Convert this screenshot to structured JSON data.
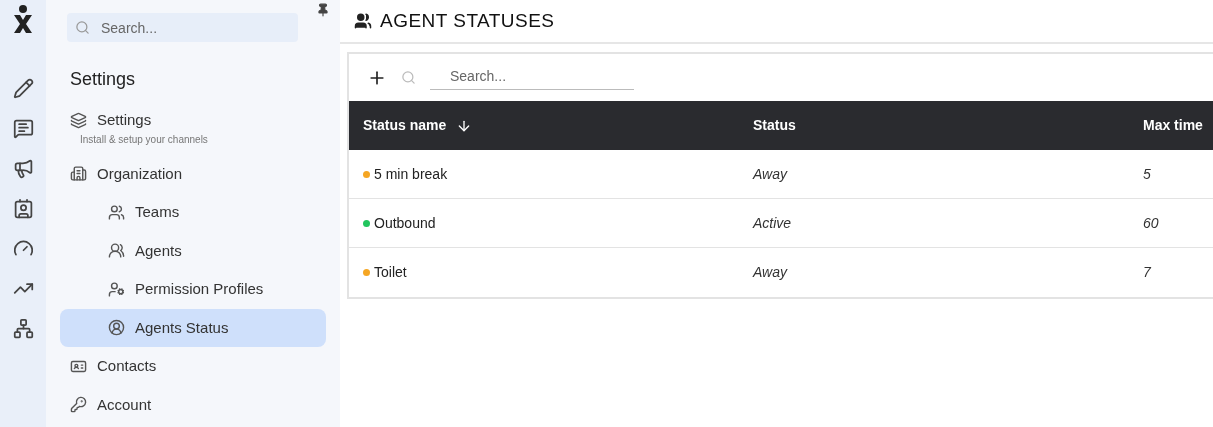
{
  "rail": {
    "icons": [
      {
        "kind": "pencil"
      },
      {
        "kind": "chat"
      },
      {
        "kind": "megaphone"
      },
      {
        "kind": "contact"
      },
      {
        "kind": "gauge"
      },
      {
        "kind": "trend"
      },
      {
        "kind": "network"
      }
    ]
  },
  "sidebar": {
    "search": {
      "placeholder": "Search..."
    },
    "heading": "Settings",
    "items": [
      {
        "label": "Settings",
        "subtitle": "Install & setup your channels",
        "selected": false
      },
      {
        "label": "Organization",
        "selected": false,
        "children": [
          {
            "label": "Teams",
            "selected": false
          },
          {
            "label": "Agents",
            "selected": false
          },
          {
            "label": "Permission Profiles",
            "selected": false
          },
          {
            "label": "Agents Status",
            "selected": true
          }
        ]
      },
      {
        "label": "Contacts",
        "selected": false
      },
      {
        "label": "Account",
        "selected": false
      }
    ]
  },
  "page": {
    "title": "AGENT STATUSES"
  },
  "toolbar": {
    "search": {
      "placeholder": "Search..."
    }
  },
  "table": {
    "columns": [
      {
        "label": "Status name",
        "sorted": true
      },
      {
        "label": "Status",
        "sorted": false
      },
      {
        "label": "Max time",
        "sorted": false
      }
    ],
    "rows": [
      {
        "name": "5 min break",
        "color": "#f5a623",
        "status": "Away",
        "max_time": "5"
      },
      {
        "name": "Outbound",
        "color": "#22c55e",
        "status": "Active",
        "max_time": "60"
      },
      {
        "name": "Toilet",
        "color": "#f5a623",
        "status": "Away",
        "max_time": "7"
      }
    ]
  }
}
